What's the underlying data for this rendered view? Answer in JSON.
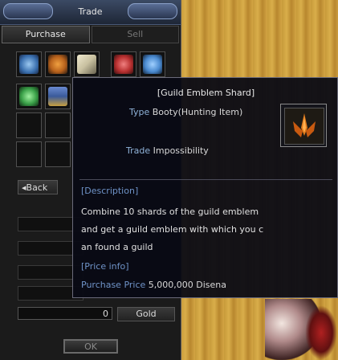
{
  "window": {
    "title": "Trade"
  },
  "tabs": {
    "purchase": "Purchase",
    "sell": "Sell"
  },
  "buttons": {
    "back": "◂Back",
    "ok": "OK"
  },
  "gold": {
    "value": "0",
    "label": "Gold"
  },
  "slots": [
    {
      "icon": "swirl-item-icon",
      "color": "#3a6fae"
    },
    {
      "icon": "guild-emblem-shard-icon",
      "color": "#b8621c"
    },
    {
      "icon": "scroll-item-icon",
      "color": "#c8c0a0"
    },
    {
      "icon": "red-potion-item-icon",
      "color": "#b83030"
    },
    {
      "icon": "blue-potion-item-icon",
      "color": "#4a8ad0"
    },
    {
      "icon": "green-potion-item-icon",
      "color": "#3aa048"
    },
    {
      "icon": "guild-banner-item-icon",
      "color": "#3a5a9a"
    }
  ],
  "tooltip": {
    "name": "[Guild Emblem Shard]",
    "type_label": "Type",
    "type_value": "Booty(Hunting Item)",
    "trade_label": "Trade",
    "trade_value": "Impossibility",
    "description_header": "[Description]",
    "description_lines": [
      "Combine 10 shards of the guild emblem",
      "and get a guild emblem with which you c",
      "an found a guild"
    ],
    "price_header": "[Price info]",
    "price_label": "Purchase Price",
    "price_value": "5,000,000 Disena"
  }
}
